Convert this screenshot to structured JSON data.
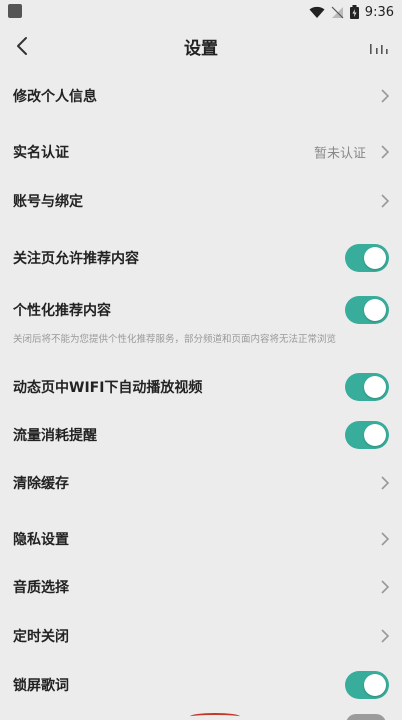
{
  "status_bar": {
    "time": "9:36"
  },
  "header": {
    "title": "设置"
  },
  "items": {
    "edit_profile": {
      "label": "修改个人信息"
    },
    "real_name": {
      "label": "实名认证",
      "value": "暂未认证"
    },
    "account_binding": {
      "label": "账号与绑定"
    },
    "follow_recommend": {
      "label": "关注页允许推荐内容",
      "on": true
    },
    "personalized": {
      "label": "个性化推荐内容",
      "on": true,
      "hint": "关闭后将不能为您提供个性化推荐服务，部分频道和页面内容将无法正常浏览"
    },
    "autoplay_wifi": {
      "label": "动态页中WIFI下自动播放视频",
      "on": true
    },
    "data_reminder": {
      "label": "流量消耗提醒",
      "on": true
    },
    "clear_cache": {
      "label": "清除缓存"
    },
    "privacy": {
      "label": "隐私设置"
    },
    "audio_quality": {
      "label": "音质选择"
    },
    "sleep_timer": {
      "label": "定时关闭"
    },
    "lock_lyrics": {
      "label": "锁屏歌词",
      "on": true
    }
  },
  "colors": {
    "accent": "#39ad9b",
    "background": "#ececec"
  }
}
